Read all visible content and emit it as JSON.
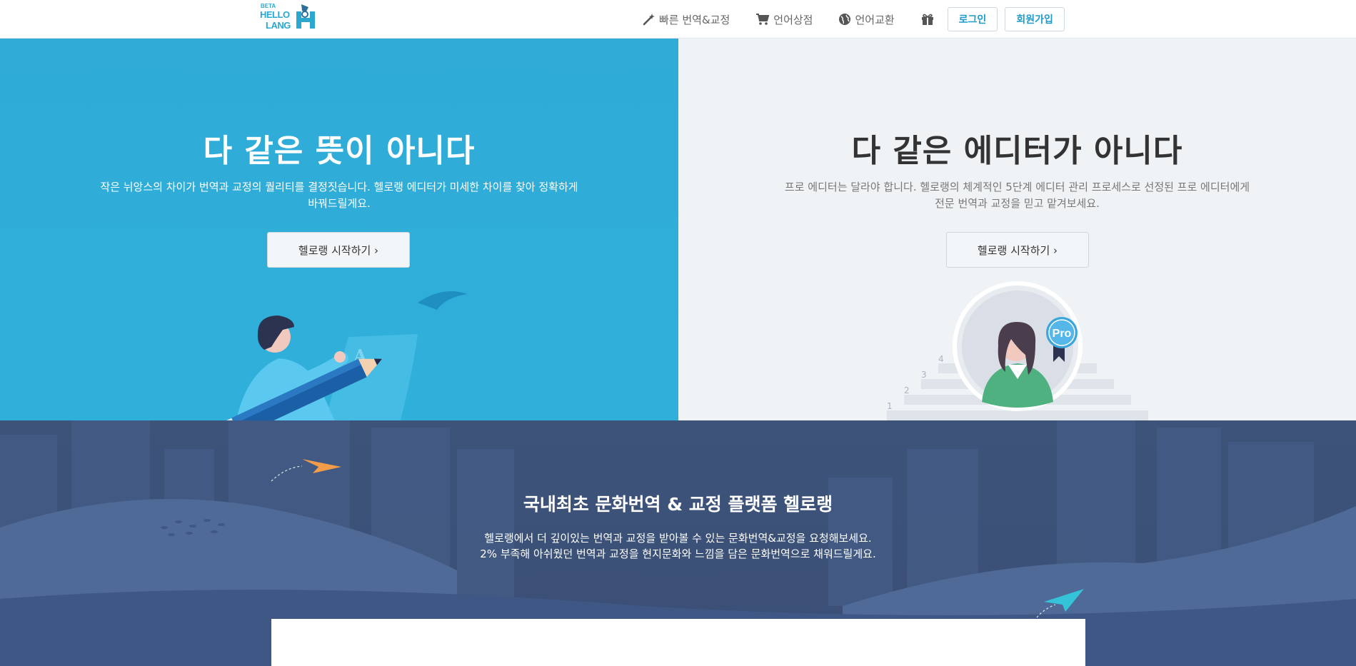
{
  "header": {
    "logo": {
      "beta": "BETA",
      "line1": "HELLO",
      "line2": "LANG"
    },
    "nav": [
      {
        "icon": "magic-wand-icon",
        "label": "빠른 번역&교정"
      },
      {
        "icon": "cart-icon",
        "label": "언어상점"
      },
      {
        "icon": "globe-icon",
        "label": "언어교환"
      }
    ],
    "gift_icon": "gift-icon",
    "login_label": "로그인",
    "signup_label": "회원가입"
  },
  "hero_left": {
    "title": "다 같은 뜻이 아니다",
    "desc_line1": "작은 뉘앙스의 차이가 번역과 교정의 퀄리티를 결정짓습니다. 헬로랭 에디터가 미세한 차이를 찾아 정확하게",
    "desc_line2": "바꿔드릴게요.",
    "button_label": "헬로랭 시작하기 ›"
  },
  "hero_right": {
    "title": "다 같은 에디터가 아니다",
    "desc_line1": "프로 에디터는 달라야 합니다. 헬로랭의 체계적인 5단계 에디터 관리 프로세스로 선정된 프로 에디터에게",
    "desc_line2": "전문 번역과 교정을 믿고 맡겨보세요.",
    "button_label": "헬로랭 시작하기 ›",
    "badge": "Pro",
    "steps": [
      "1",
      "2",
      "3",
      "4"
    ]
  },
  "band": {
    "title": "국내최초 문화번역 & 교정 플랫폼 헬로랭",
    "desc_line1": "헬로랭에서 더 깊이있는 번역과 교정을 받아볼 수 있는 문화번역&교정을 요청해보세요.",
    "desc_line2": "2% 부족해 아쉬웠던 번역과 교정을 현지문화와 느낌을 담은 문화번역으로 채워드릴게요."
  },
  "colors": {
    "accent": "#2aa8d0",
    "hero_left_bg": "#2fabd6",
    "hero_right_bg": "#f0f3f5",
    "band_bg": "#3d5378",
    "link": "#1e9bc9"
  }
}
